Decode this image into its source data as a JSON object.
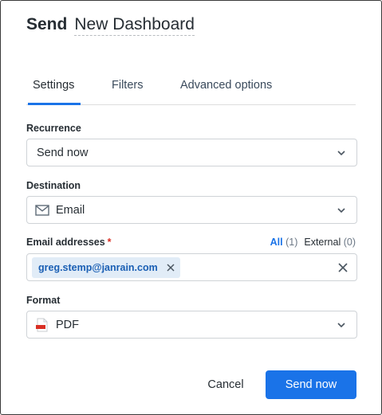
{
  "dialog": {
    "title_prefix": "Send",
    "title_name": "New Dashboard"
  },
  "tabs": [
    {
      "label": "Settings",
      "active": true
    },
    {
      "label": "Filters",
      "active": false
    },
    {
      "label": "Advanced options",
      "active": false
    }
  ],
  "recurrence": {
    "label": "Recurrence",
    "value": "Send now"
  },
  "destination": {
    "label": "Destination",
    "value": "Email",
    "icon": "envelope-icon"
  },
  "email": {
    "label": "Email addresses",
    "required_marker": "*",
    "filter_all_label": "All",
    "filter_all_count": "(1)",
    "filter_external_label": "External",
    "filter_external_count": "(0)",
    "chips": [
      "greg.stemp@janrain.com"
    ]
  },
  "format": {
    "label": "Format",
    "value": "PDF",
    "icon": "pdf-file-icon"
  },
  "buttons": {
    "cancel": "Cancel",
    "send": "Send now"
  },
  "colors": {
    "accent": "#1a73e8",
    "chip_bg": "#e1ecf7",
    "required": "#d93025"
  }
}
